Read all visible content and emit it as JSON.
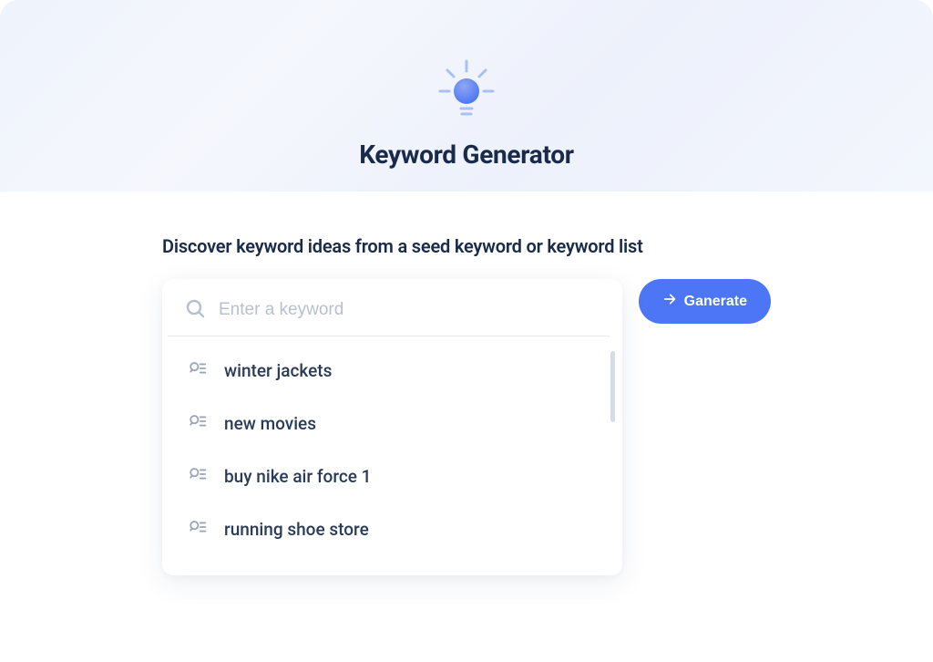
{
  "header": {
    "title": "Keyword Generator"
  },
  "main": {
    "subtitle": "Discover keyword ideas from a seed keyword or keyword list",
    "search": {
      "placeholder": "Enter a keyword",
      "value": ""
    },
    "suggestions": [
      {
        "label": "winter jackets"
      },
      {
        "label": "new movies"
      },
      {
        "label": "buy nike air force 1"
      },
      {
        "label": "running shoe store"
      }
    ],
    "generate_button_label": "Ganerate"
  }
}
